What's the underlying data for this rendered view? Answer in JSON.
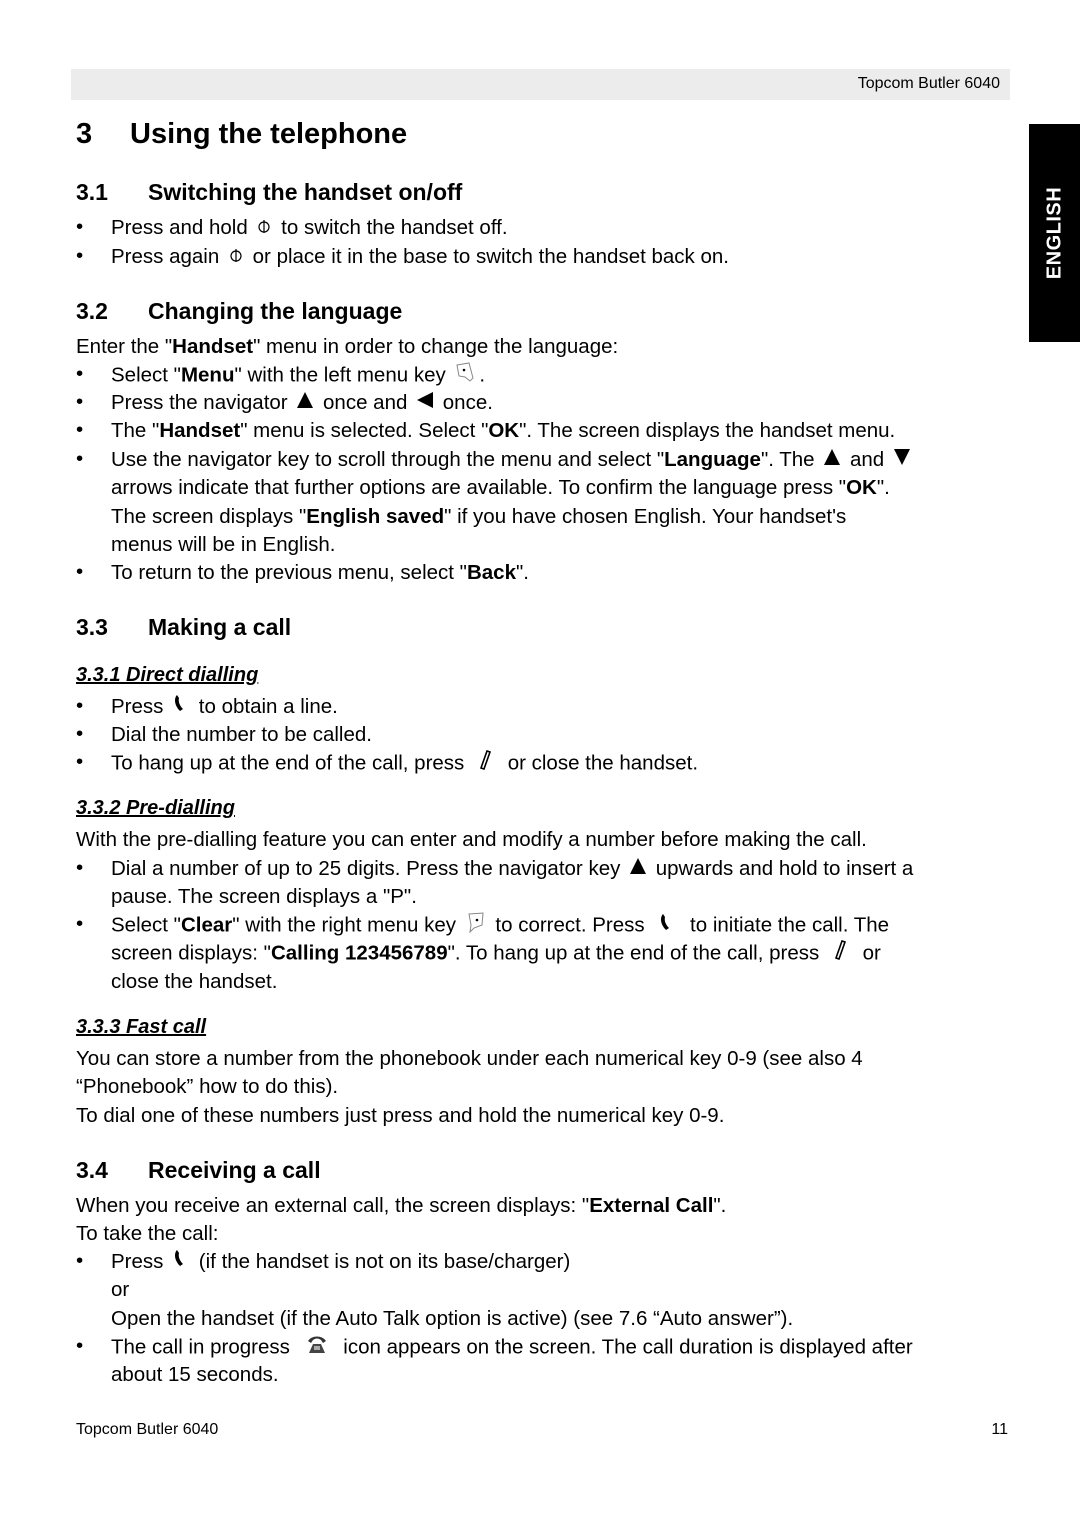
{
  "header": {
    "title": "Topcom Butler 6040"
  },
  "side_tab": {
    "label": "ENGLISH"
  },
  "chapter": {
    "number": "3",
    "title": "Using the telephone"
  },
  "sections": {
    "s31": {
      "number": "3.1",
      "title": "Switching the handset on/off",
      "b1": [
        "Press and hold",
        "to switch the handset off."
      ],
      "b2": [
        "Press again",
        "or place it in the base to switch the handset back on."
      ]
    },
    "s32": {
      "number": "3.2",
      "title": "Changing the language",
      "intro": [
        "Enter the \"",
        "Handset",
        "\" menu in order to change the language:"
      ],
      "b1": [
        "Select \"",
        "Menu",
        "\" with the left menu key",
        "."
      ],
      "b2": [
        "Press the navigator",
        "once and",
        "once."
      ],
      "b3": [
        "The \"",
        "Handset",
        "\" menu is selected. Select \"",
        "OK",
        "\". The screen displays the handset menu."
      ],
      "b4_l1": [
        "Use the navigator key to scroll through the menu and select \"",
        "Language",
        "\". The",
        "and"
      ],
      "b4_l2": [
        "arrows indicate that further options are available. To confirm the language press \"",
        "OK",
        "\"."
      ],
      "b4_l3": [
        "The screen displays \"",
        "English saved",
        "\" if you have chosen English. Your handset's"
      ],
      "b4_l4": "menus will be in English.",
      "b5": [
        "To return to the previous menu, select \"",
        "Back",
        "\"."
      ]
    },
    "s33": {
      "number": "3.3",
      "title": "Making a call",
      "sub1": {
        "title": "3.3.1 Direct dialling",
        "b1": [
          "Press",
          "to obtain a line."
        ],
        "b2": "Dial the number to be called.",
        "b3": [
          "To hang up at the end of the call, press",
          "or close the handset."
        ]
      },
      "sub2": {
        "title": "3.3.2 Pre-dialling",
        "intro": "With the pre-dialling feature you can enter and modify a number before making the call.",
        "b1_l1": [
          "Dial a number of up to 25 digits. Press the navigator key",
          "upwards and hold to insert a"
        ],
        "b1_l2": "pause. The screen displays a \"P\".",
        "b2_l1": [
          "Select \"",
          "Clear",
          "\" with the right menu key",
          "to correct. Press",
          "to initiate the call. The"
        ],
        "b2_l2": [
          "screen displays: \"",
          "Calling 123456789",
          "\". To hang up at the end of the call, press",
          "or"
        ],
        "b2_l3": "close the handset."
      },
      "sub3": {
        "title": "3.3.3 Fast call",
        "p1_l1": "You can store a number from the phonebook under each numerical key 0-9 (see also 4",
        "p1_l2": "“Phonebook” how to do this).",
        "p2": "To dial one of these numbers just press and hold the numerical key 0-9."
      }
    },
    "s34": {
      "number": "3.4",
      "title": "Receiving a call",
      "intro": [
        "When you receive an external call, the screen displays: \"",
        "External Call",
        "\"."
      ],
      "intro2": "To take the call:",
      "b1_l1": [
        "Press",
        "(if the handset is not on its base/charger)"
      ],
      "b1_l2": "or",
      "b1_l3": "Open the handset (if the Auto Talk option is active) (see 7.6 “Auto answer”).",
      "b2_l1": [
        "The call in progress",
        "icon appears on the screen. The call duration is displayed after"
      ],
      "b2_l2": "about 15 seconds."
    }
  },
  "bullet_char": "•",
  "footer": {
    "left": "Topcom Butler 6040",
    "page": "11"
  }
}
